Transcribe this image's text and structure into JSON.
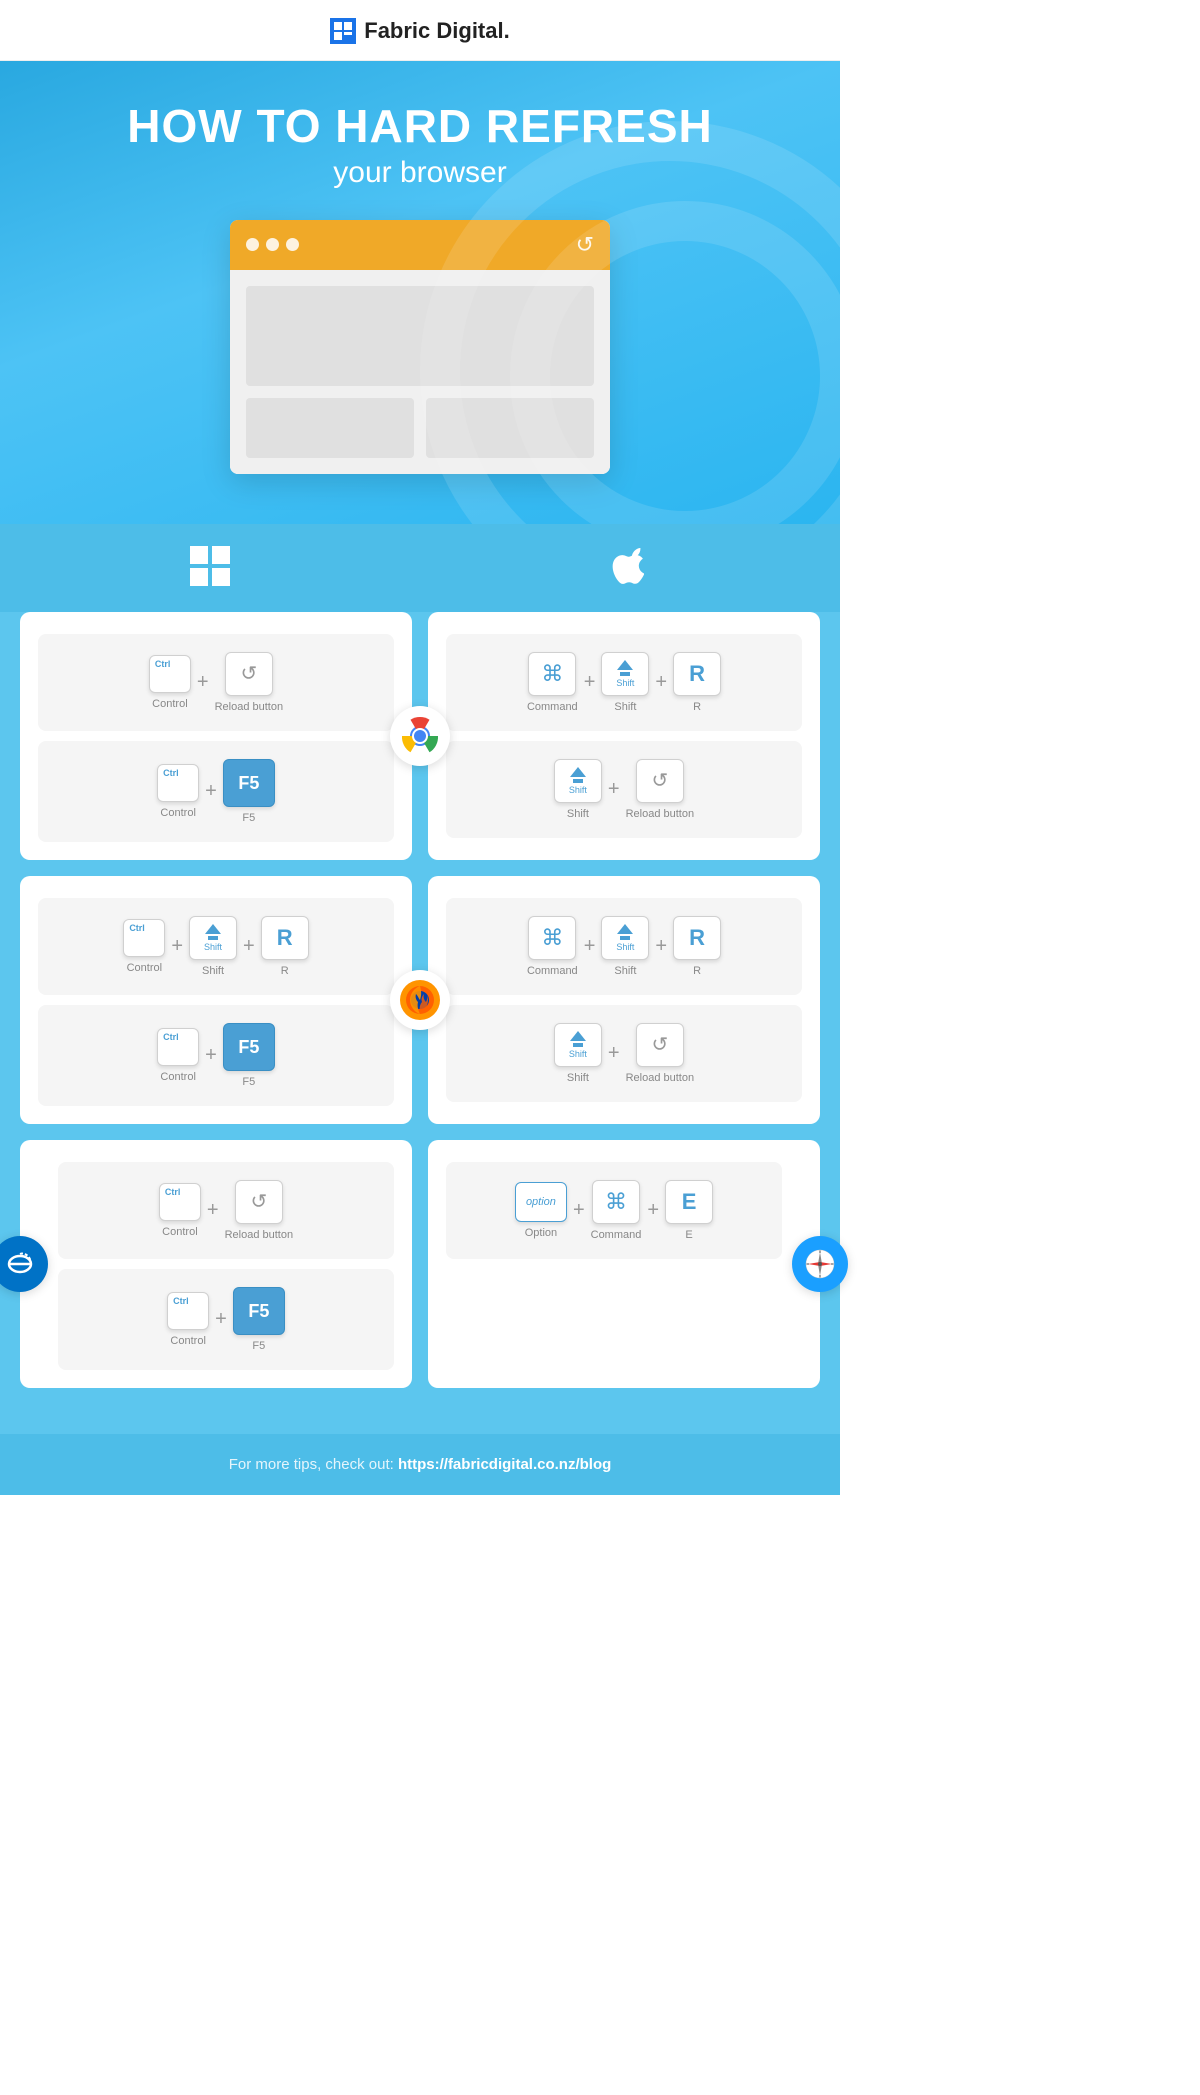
{
  "header": {
    "logo_icon": "F",
    "logo_text": "Fabric Digital."
  },
  "hero": {
    "title": "HOW TO HARD REFRESH",
    "subtitle": "your browser"
  },
  "os": {
    "windows_label": "Windows",
    "apple_label": "Apple"
  },
  "chrome": {
    "win": {
      "row1": {
        "key1": "Ctrl",
        "key1_label": "Control",
        "key2": "↺",
        "key2_label": "Reload button"
      },
      "row2": {
        "key1": "Ctrl",
        "key1_label": "Control",
        "key2": "F5",
        "key2_label": "F5"
      }
    },
    "mac": {
      "row1": {
        "key1": "⌘",
        "key1_label": "Command",
        "key2_label": "Shift",
        "key3": "R",
        "key3_label": "R"
      },
      "row2": {
        "key1_label": "Shift",
        "key2": "↺",
        "key2_label": "Reload button"
      }
    }
  },
  "firefox": {
    "win": {
      "row1": {
        "key1": "Ctrl",
        "key1_label": "Control",
        "key2_label": "Shift",
        "key3": "R",
        "key3_label": "R"
      },
      "row2": {
        "key1": "Ctrl",
        "key1_label": "Control",
        "key2": "F5",
        "key2_label": "F5"
      }
    },
    "mac": {
      "row1": {
        "key1": "⌘",
        "key1_label": "Command",
        "key2_label": "Shift",
        "key3": "R",
        "key3_label": "R"
      },
      "row2": {
        "key1_label": "Shift",
        "key2": "↺",
        "key2_label": "Reload button"
      }
    }
  },
  "ie": {
    "win": {
      "row1": {
        "key1": "Ctrl",
        "key1_label": "Control",
        "key2": "↺",
        "key2_label": "Reload button"
      },
      "row2": {
        "key1": "Ctrl",
        "key1_label": "Control",
        "key2": "F5",
        "key2_label": "F5"
      }
    }
  },
  "safari": {
    "mac": {
      "row1": {
        "key1_label": "Option",
        "key2": "⌘",
        "key2_label": "Command",
        "key3": "E",
        "key3_label": "E"
      }
    }
  },
  "footer": {
    "text": "For more tips, check out: ",
    "link_text": "https://fabricdigital.co.nz/blog",
    "link_url": "https://fabricdigital.co.nz/blog"
  }
}
